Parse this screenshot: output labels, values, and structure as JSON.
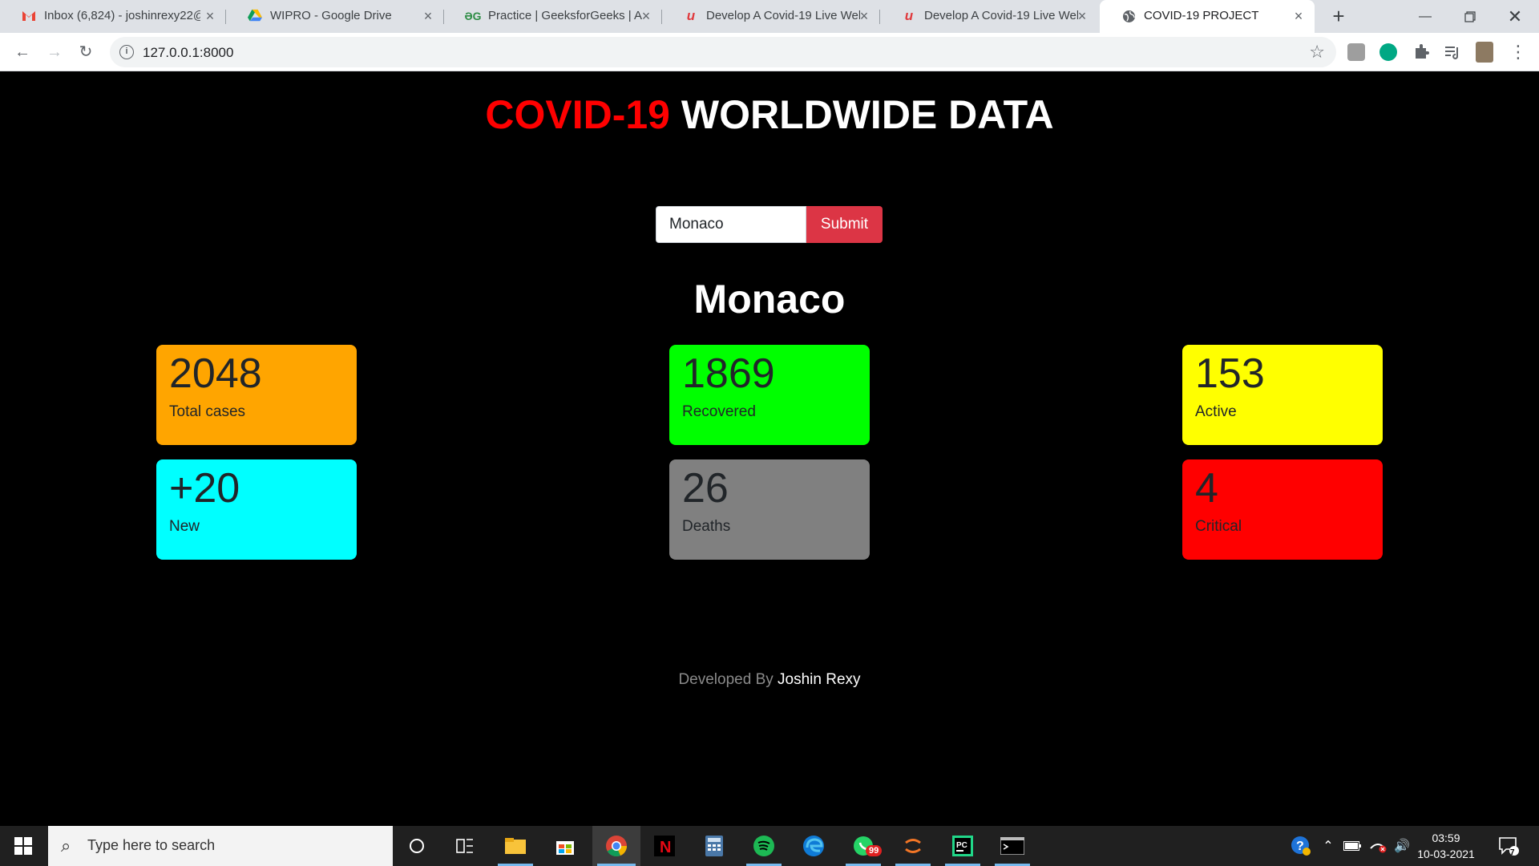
{
  "browser": {
    "tabs": [
      {
        "title": "Inbox (6,824) - joshinrexy22@",
        "icon": "gmail-icon"
      },
      {
        "title": "WIPRO - Google Drive",
        "icon": "google-drive-icon"
      },
      {
        "title": "Practice | GeeksforGeeks | A c",
        "icon": "geeksforgeeks-icon"
      },
      {
        "title": "Develop A Covid-19 Live Wel",
        "icon": "udemy-icon"
      },
      {
        "title": "Develop A Covid-19 Live Wel",
        "icon": "udemy-icon"
      },
      {
        "title": "COVID-19 PROJECT",
        "icon": "globe-icon"
      }
    ],
    "url": "127.0.0.1:8000"
  },
  "page": {
    "title_highlight": "COVID-19",
    "title_rest": "WORLDWIDE DATA",
    "search": {
      "value": "Monaco",
      "button": "Submit"
    },
    "country": "Monaco",
    "stats": [
      {
        "value": "2048",
        "label": "Total cases",
        "color": "#ffa500"
      },
      {
        "value": "1869",
        "label": "Recovered",
        "color": "#00ff00"
      },
      {
        "value": "153",
        "label": "Active",
        "color": "#ffff00"
      },
      {
        "value": "+20",
        "label": "New",
        "color": "#00ffff"
      },
      {
        "value": "26",
        "label": "Deaths",
        "color": "#808080"
      },
      {
        "value": "4",
        "label": "Critical",
        "color": "#ff0000"
      }
    ],
    "footer": {
      "prefix": "Developed By",
      "author": "Joshin Rexy"
    }
  },
  "taskbar": {
    "search_placeholder": "Type here to search",
    "whatsapp_badge": "99",
    "time": "03:59",
    "date": "10-03-2021",
    "notification_count": "7"
  }
}
